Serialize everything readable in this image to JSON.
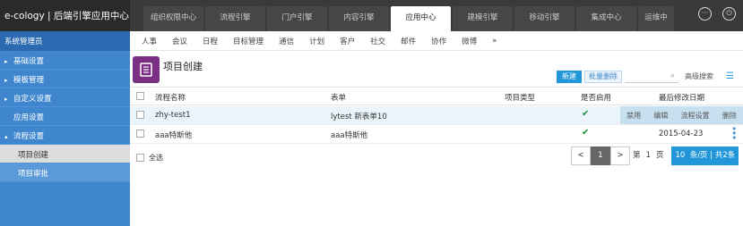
{
  "app": {
    "title": "e-cology | 后端引擎应用中心"
  },
  "topnav": [
    {
      "label": "组织权限中心"
    },
    {
      "label": "流程引擎"
    },
    {
      "label": "门户引擎"
    },
    {
      "label": "内容引擎"
    },
    {
      "label": "应用中心"
    },
    {
      "label": "建模引擎"
    },
    {
      "label": "移动引擎"
    },
    {
      "label": "集成中心"
    },
    {
      "label": "运维中"
    }
  ],
  "topicons": {
    "more": "···",
    "power": "⏻"
  },
  "sidebar": {
    "header": "系统管理员",
    "items": [
      {
        "label": "基础设置",
        "arrow": "▸"
      },
      {
        "label": "模板管理",
        "arrow": "▸"
      },
      {
        "label": "自定义设置",
        "arrow": "▸"
      },
      {
        "label": "应用设置",
        "arrow": ""
      },
      {
        "label": "流程设置",
        "arrow": "▴"
      },
      {
        "label": "项目创建",
        "arrow": ""
      },
      {
        "label": "项目审批",
        "arrow": ""
      }
    ]
  },
  "subnav": [
    "人事",
    "会议",
    "日程",
    "目标管理",
    "通信",
    "计划",
    "客户",
    "社交",
    "邮件",
    "协作",
    "微博",
    "»"
  ],
  "page": {
    "title": "项目创建"
  },
  "toolbar": {
    "new": "新建",
    "batch_delete": "批量删除",
    "search_placeholder": "",
    "advanced": "高级搜索"
  },
  "table": {
    "headers": [
      "流程名称",
      "表单",
      "项目类型",
      "是否启用",
      "最后修改日期"
    ],
    "rows": [
      {
        "name": "zhy-test1",
        "form": "lytest 新表单10",
        "enabled": "✔",
        "date": "",
        "ops": [
          "禁用",
          "编辑",
          "流程设置",
          "删除"
        ]
      },
      {
        "name": "aaa特斯他",
        "form": "aaa特斯他",
        "enabled": "✔",
        "date": "2015-04-23"
      }
    ]
  },
  "footer": {
    "select_all": "全选",
    "prev": "<",
    "page": "1",
    "next": ">",
    "page_prefix": "第",
    "page_num": "1",
    "page_suffix": "页",
    "page_size": "10",
    "size_text": "条/页 | 共2条"
  }
}
